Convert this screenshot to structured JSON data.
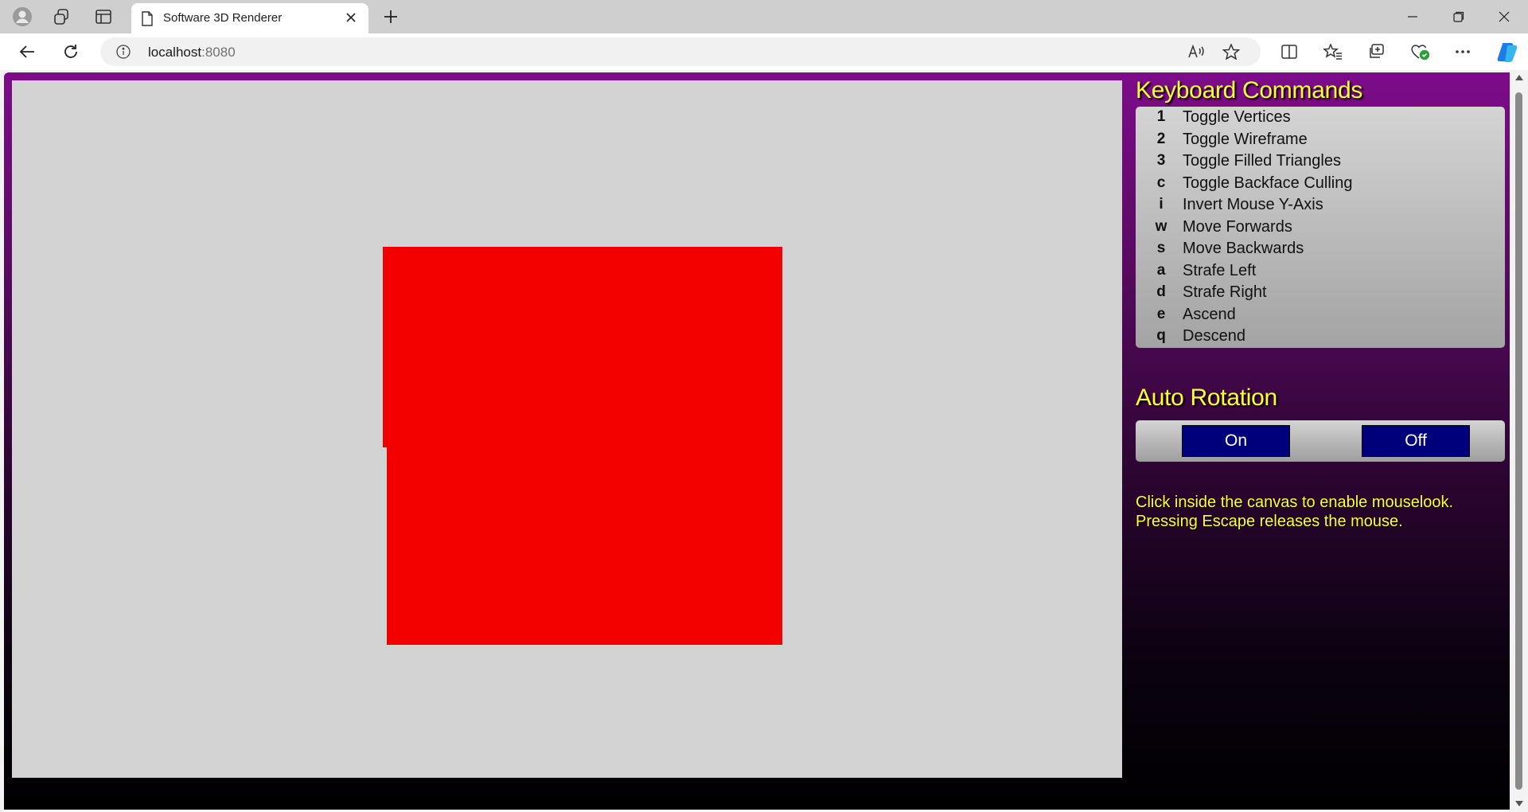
{
  "browser": {
    "tab_title": "Software 3D Renderer",
    "address_host": "localhost",
    "address_port": ":8080",
    "icons": [
      "profile-icon",
      "workspaces-icon",
      "tab-actions-icon",
      "page-icon",
      "close-icon",
      "plus-icon",
      "minimize-icon",
      "restore-icon",
      "close-window-icon",
      "back-icon",
      "refresh-icon",
      "info-icon",
      "read-aloud-icon",
      "favorite-star-icon",
      "split-screen-icon",
      "favorites-icon",
      "collections-icon",
      "browser-essentials-icon",
      "more-icon",
      "copilot-icon"
    ]
  },
  "sidebar": {
    "keyboard_heading": "Keyboard Commands",
    "commands": [
      {
        "key": "1",
        "desc": "Toggle Vertices"
      },
      {
        "key": "2",
        "desc": "Toggle Wireframe"
      },
      {
        "key": "3",
        "desc": "Toggle Filled Triangles"
      },
      {
        "key": "c",
        "desc": "Toggle Backface Culling"
      },
      {
        "key": "i",
        "desc": "Invert Mouse Y-Axis"
      },
      {
        "key": "w",
        "desc": "Move Forwards"
      },
      {
        "key": "s",
        "desc": "Move Backwards"
      },
      {
        "key": "a",
        "desc": "Strafe Left"
      },
      {
        "key": "d",
        "desc": "Strafe Right"
      },
      {
        "key": "e",
        "desc": "Ascend"
      },
      {
        "key": "q",
        "desc": "Descend"
      }
    ],
    "rotation_heading": "Auto Rotation",
    "on_label": "On",
    "off_label": "Off",
    "hint_line1": "Click inside the canvas to enable mouselook.",
    "hint_line2": "Pressing Escape releases the mouse."
  },
  "colors": {
    "canvas_bg": "#d3d3d3",
    "shape": "#f20000",
    "heading": "#ffff33",
    "button": "#00007a",
    "page_gradient_top": "#7d0c8a"
  }
}
